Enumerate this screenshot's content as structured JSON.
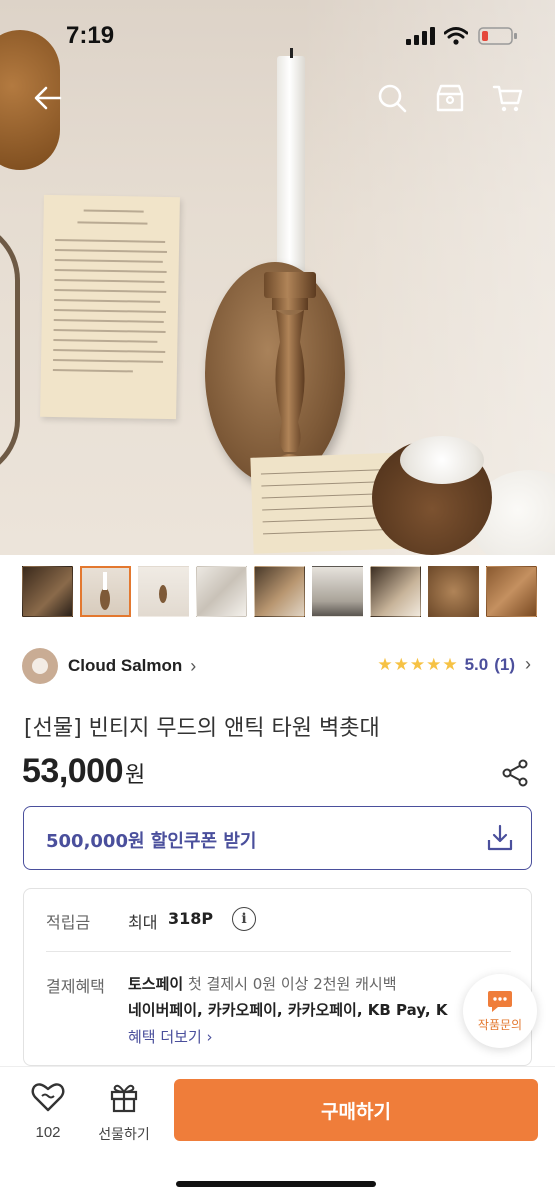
{
  "status_bar": {
    "time": "7:19"
  },
  "nav": {
    "icons": [
      "back-arrow-icon",
      "search-icon",
      "store-icon",
      "cart-icon"
    ]
  },
  "gallery": {
    "thumbnail_count": 9,
    "selected_index": 1
  },
  "seller": {
    "name": "Cloud Salmon",
    "chevron": "›"
  },
  "rating": {
    "stars": "★★★★★",
    "score": "5.0",
    "count": "(1)",
    "chevron": "›"
  },
  "product": {
    "title": "[선물] 빈티지 무드의 앤틱 타원 벽촛대",
    "price": "53,000",
    "price_unit": "원"
  },
  "coupon": {
    "label": "500,000원 할인쿠폰 받기"
  },
  "benefits": {
    "points_label": "적립금",
    "points_prefix": "최대",
    "points_value": "318P",
    "info_glyph": "i",
    "payment_label": "결제혜택",
    "toss_brand": "토스페이",
    "toss_text": " 첫 결제시 0원 이상 2천원 캐시백",
    "pay_methods": "네이버페이, 카카오페이, 카카오페이, KB Pay, K",
    "more_label": "혜택 더보기 ›"
  },
  "inquiry": {
    "label": "작품문의"
  },
  "bottom_bar": {
    "likes": "102",
    "gift_label": "선물하기",
    "buy_label": "구매하기"
  },
  "colors": {
    "accent_orange": "#ef7d3a",
    "brand_indigo": "#4a4f9c",
    "star_yellow": "#f6c244"
  }
}
